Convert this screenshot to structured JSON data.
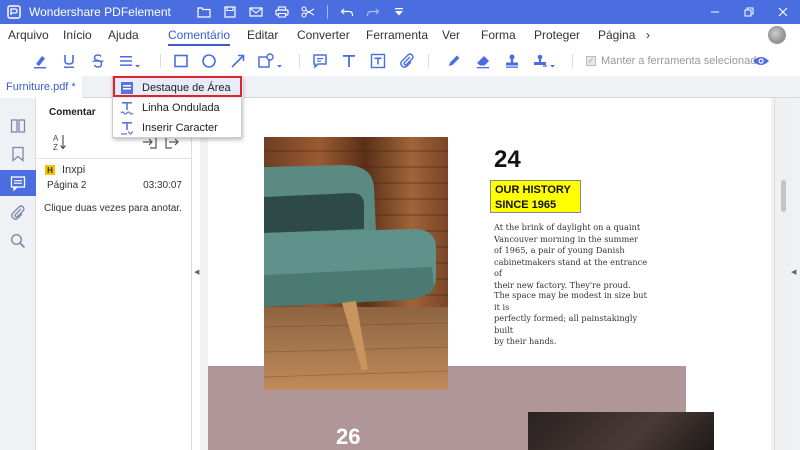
{
  "app": {
    "title": "Wondershare PDFelement"
  },
  "menu": {
    "items": [
      "Arquivo",
      "Início",
      "Ajuda",
      "Comentário",
      "Editar",
      "Converter",
      "Ferramenta",
      "Ver",
      "Forma",
      "Proteger",
      "Página"
    ],
    "active": "Comentário",
    "more": "›"
  },
  "toolbar": {
    "keep_tool_label": "Manter a ferramenta selecionada",
    "keep_tool_checked": true
  },
  "tab": {
    "label": "Furniture.pdf *"
  },
  "panel": {
    "title": "Comentar",
    "comment": {
      "badge": "H",
      "author": "Inxpi",
      "page": "Página 2",
      "time": "03:30:07"
    },
    "hint": "Clique duas vezes para anotar."
  },
  "dropdown": {
    "items": [
      {
        "label": "Destaque de Área",
        "icon": "area-highlight-icon",
        "selected": true
      },
      {
        "label": "Linha Ondulada",
        "icon": "wavy-underline-icon",
        "selected": false
      },
      {
        "label": "Inserir Caracter",
        "icon": "insert-text-icon",
        "selected": false
      }
    ]
  },
  "document": {
    "number_top": "24",
    "history_lines": [
      "OUR HISTORY",
      "SINCE 1965"
    ],
    "paragraph1": [
      "At the brink of daylight on a quaint",
      "Vancouver morning in the summer",
      "of 1965, a pair of young Danish",
      "cabinetmakers stand at the entrance of",
      "their new factory. They're proud."
    ],
    "paragraph2": [
      "The space may be modest in size but it is",
      "perfectly formed; all painstakingly built",
      "by their hands."
    ],
    "number_bottom": "26"
  },
  "colors": {
    "titlebar": "#4a6ee0",
    "accent": "#3a5ccc",
    "highlight_yellow": "#ffff00",
    "pink_band": "#b09699",
    "selection_border": "#e0242a"
  }
}
